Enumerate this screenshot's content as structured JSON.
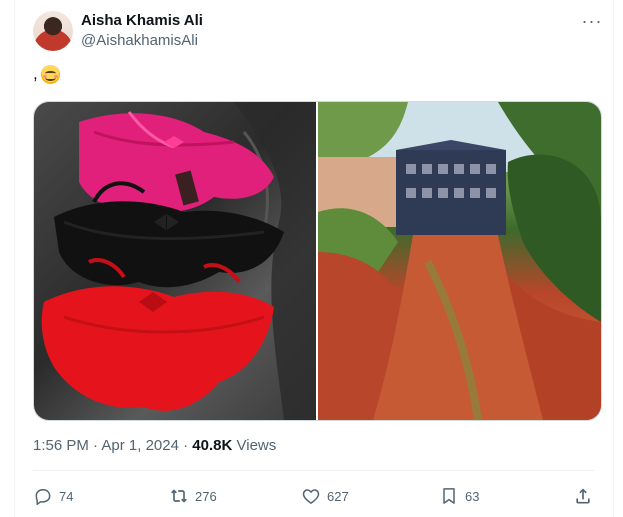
{
  "author": {
    "display_name": "Aisha Khamis Ali",
    "handle": "@AishakhamisAli",
    "avatar_icon": "avatar-photo"
  },
  "menu": {
    "more_icon": "more-horizontal-icon",
    "more_label": "···"
  },
  "tweet": {
    "text": ",",
    "emoji_icon": "smiling-face-with-smiling-eyes-emoji"
  },
  "media": {
    "photos": [
      {
        "icon": "photo-lingerie"
      },
      {
        "icon": "photo-red-soil-path-gate"
      }
    ]
  },
  "meta": {
    "time": "1:56 PM",
    "separator": "·",
    "date": "Apr 1, 2024",
    "views_count": "40.8K",
    "views_label": "Views"
  },
  "actions": {
    "reply_count": "74",
    "repost_count": "276",
    "like_count": "627",
    "bookmark_count": "63"
  },
  "colors": {
    "text_primary": "#0f1419",
    "text_secondary": "#536471",
    "border": "#cfd9de",
    "divider": "#eff3f4"
  }
}
